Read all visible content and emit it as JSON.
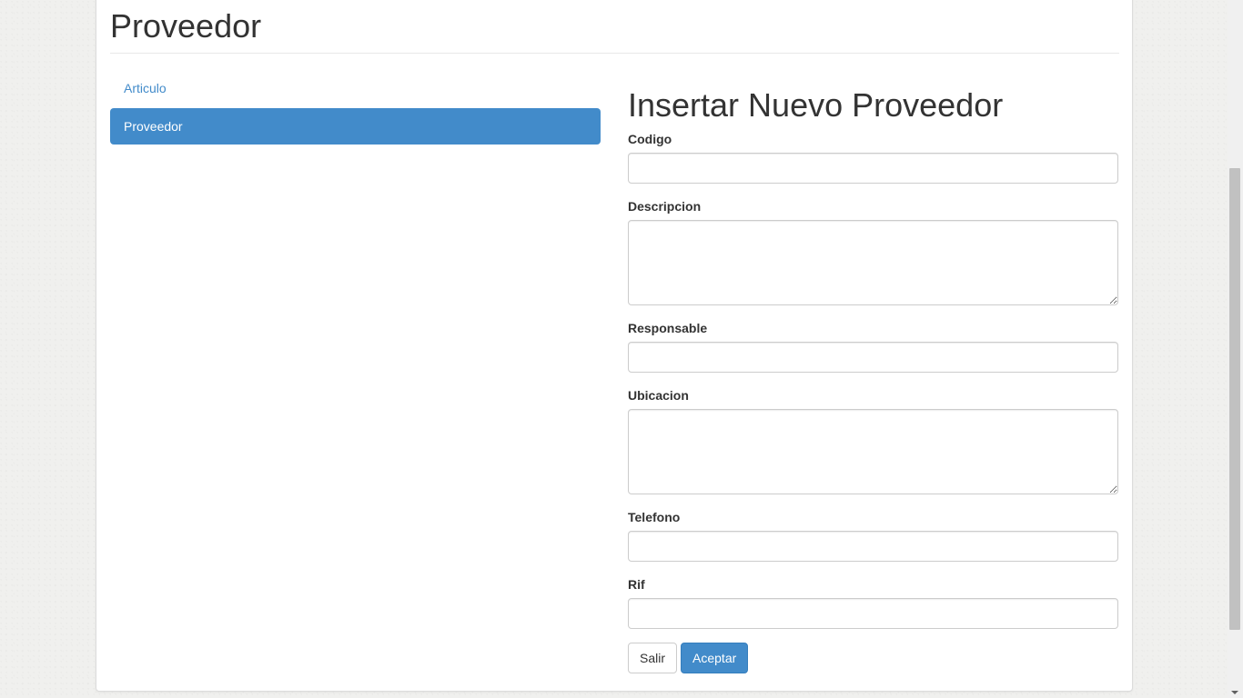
{
  "header": {
    "title": "Proveedor"
  },
  "sidebar": {
    "items": [
      {
        "label": "Articulo",
        "active": false
      },
      {
        "label": "Proveedor",
        "active": true
      }
    ]
  },
  "form": {
    "title": "Insertar Nuevo Proveedor",
    "fields": {
      "codigo": {
        "label": "Codigo",
        "value": ""
      },
      "descripcion": {
        "label": "Descripcion",
        "value": ""
      },
      "responsable": {
        "label": "Responsable",
        "value": ""
      },
      "ubicacion": {
        "label": "Ubicacion",
        "value": ""
      },
      "telefono": {
        "label": "Telefono",
        "value": ""
      },
      "rif": {
        "label": "Rif",
        "value": ""
      }
    },
    "buttons": {
      "cancel_label": "Salir",
      "submit_label": "Aceptar"
    }
  },
  "colors": {
    "accent": "#428bca",
    "background": "#f0f0ee"
  },
  "icons": {
    "scroll_down": "chevron-down-icon"
  }
}
